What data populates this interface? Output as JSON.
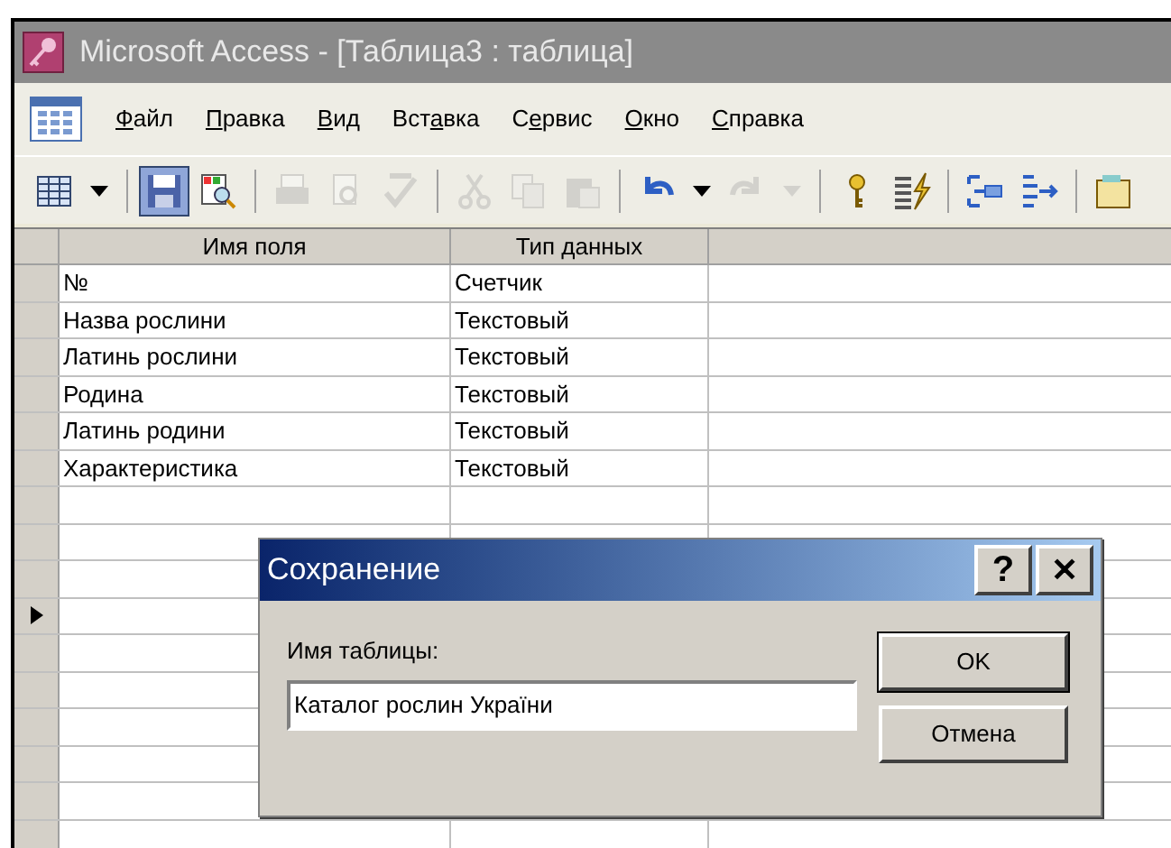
{
  "window": {
    "title": "Microsoft Access - [Таблица3 : таблица]"
  },
  "menu": [
    {
      "key": "Ф",
      "post": "айл"
    },
    {
      "key": "П",
      "post": "равка"
    },
    {
      "key": "В",
      "post": "ид"
    },
    {
      "pre": "Вст",
      "key": "а",
      "post": "вка"
    },
    {
      "pre": "С",
      "key": "е",
      "post": "рвис"
    },
    {
      "key": "О",
      "post": "кно"
    },
    {
      "key": "С",
      "post": "правка"
    }
  ],
  "toolbar": [
    {
      "kind": "view",
      "disabled": false
    },
    {
      "kind": "dropdown",
      "disabled": false
    },
    {
      "kind": "separator"
    },
    {
      "kind": "save",
      "disabled": false,
      "pressed": true
    },
    {
      "kind": "search",
      "disabled": false
    },
    {
      "kind": "separator"
    },
    {
      "kind": "print",
      "disabled": true
    },
    {
      "kind": "preview",
      "disabled": true
    },
    {
      "kind": "spelling",
      "disabled": true
    },
    {
      "kind": "separator"
    },
    {
      "kind": "cut",
      "disabled": true
    },
    {
      "kind": "copy",
      "disabled": true
    },
    {
      "kind": "paste",
      "disabled": true
    },
    {
      "kind": "separator"
    },
    {
      "kind": "undo",
      "disabled": false
    },
    {
      "kind": "dropdown",
      "disabled": false
    },
    {
      "kind": "redo",
      "disabled": true
    },
    {
      "kind": "dropdown",
      "disabled": true
    },
    {
      "kind": "separator"
    },
    {
      "kind": "key",
      "disabled": false
    },
    {
      "kind": "builder",
      "disabled": false
    },
    {
      "kind": "separator"
    },
    {
      "kind": "insert-rows",
      "disabled": false
    },
    {
      "kind": "delete-rows",
      "disabled": false
    },
    {
      "kind": "separator"
    },
    {
      "kind": "properties",
      "disabled": false
    }
  ],
  "table": {
    "columns": [
      "Имя поля",
      "Тип данных"
    ],
    "rows": [
      {
        "cells": [
          "№",
          "Счетчик"
        ],
        "selected": false
      },
      {
        "cells": [
          "Назва рослини",
          "Текстовый"
        ],
        "selected": false
      },
      {
        "cells": [
          "Латинь рослини",
          "Текстовый"
        ],
        "selected": false
      },
      {
        "cells": [
          "Родина",
          "Текстовый"
        ],
        "selected": false
      },
      {
        "cells": [
          "Латинь родини",
          "Текстовый"
        ],
        "selected": false
      },
      {
        "cells": [
          "Характеристика",
          "Текстовый"
        ],
        "selected": false
      },
      {
        "cells": [],
        "selected": false
      },
      {
        "cells": [],
        "selected": false
      },
      {
        "cells": [],
        "selected": false
      },
      {
        "cells": [],
        "selected": true
      },
      {
        "cells": [],
        "selected": false
      },
      {
        "cells": [],
        "selected": false
      },
      {
        "cells": [],
        "selected": false
      },
      {
        "cells": [],
        "selected": false
      },
      {
        "cells": [],
        "selected": false
      },
      {
        "cells": [],
        "selected": false
      }
    ]
  },
  "dialog": {
    "title": "Сохранение",
    "help": "?",
    "close": "✕",
    "label": "Имя таблицы:",
    "value": "Каталог рослин України",
    "buttons": [
      {
        "label": "OK",
        "default": true
      },
      {
        "label": "Отмена",
        "default": false
      }
    ]
  }
}
